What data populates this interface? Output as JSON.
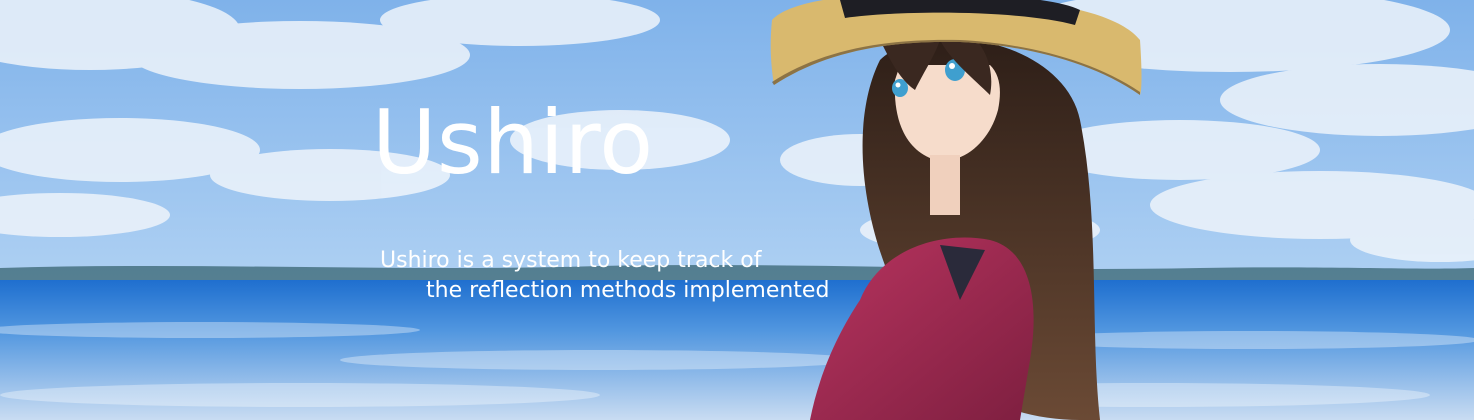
{
  "banner": {
    "title": "Ushiro",
    "subtitle_line1": "Ushiro is a system to keep track of",
    "subtitle_line2": "the reflection methods implemented"
  },
  "colors": {
    "sky": "#9cc6ef",
    "cloud": "#eef4fb",
    "sea": "#2f82d6",
    "text": "#ffffff",
    "hat": "#d9b96e",
    "hair": "#3d2a20",
    "jacket": "#a0274f"
  }
}
